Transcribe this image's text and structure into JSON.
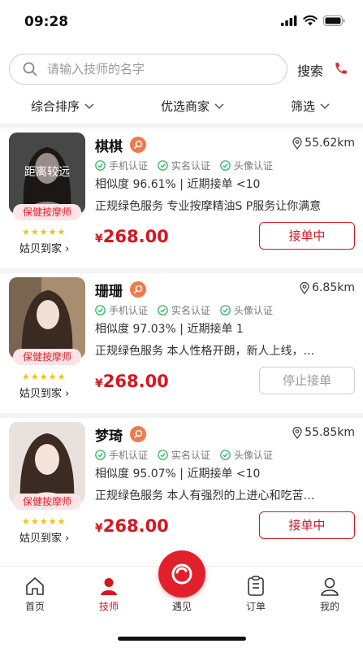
{
  "status_bar": {
    "time": "09:28"
  },
  "search": {
    "placeholder": "请输入技师的名字",
    "button_label": "搜索"
  },
  "filters": [
    {
      "label": "综合排序"
    },
    {
      "label": "优选商家"
    },
    {
      "label": "筛选"
    }
  ],
  "technicians": [
    {
      "name": "棋棋",
      "distance": "55.62km",
      "avatar_overlay": "距离较远",
      "role": "保健按摩师",
      "rating_stars": 5,
      "shop": "姑贝到家",
      "certs": [
        "手机认证",
        "实名认证",
        "头像认证"
      ],
      "stats": "相似度 96.61% | 近期接单 <10",
      "description": "正规绿色服务 专业按摩精油S P服务让你满意",
      "currency": "¥",
      "price": "268.00",
      "action_label": "接单中",
      "action_state": "active"
    },
    {
      "name": "珊珊",
      "distance": "6.85km",
      "avatar_overlay": "",
      "role": "保健按摩师",
      "rating_stars": 5,
      "shop": "姑贝到家",
      "certs": [
        "手机认证",
        "实名认证",
        "头像认证"
      ],
      "stats": "相似度 97.03% | 近期接单 1",
      "description": "正规绿色服务 本人性格开朗，新人上线，…",
      "currency": "¥",
      "price": "268.00",
      "action_label": "停止接单",
      "action_state": "stopped"
    },
    {
      "name": "梦琦",
      "distance": "55.85km",
      "avatar_overlay": "",
      "role": "保健按摩师",
      "rating_stars": 5,
      "shop": "姑贝到家",
      "certs": [
        "手机认证",
        "实名认证",
        "头像认证"
      ],
      "stats": "相似度 95.07% | 近期接单 <10",
      "description": "正规绿色服务 本人有强烈的上进心和吃苦…",
      "currency": "¥",
      "price": "268.00",
      "action_label": "接单中",
      "action_state": "active"
    }
  ],
  "tabbar": {
    "items": [
      {
        "label": "首页",
        "icon": "home-icon",
        "active": false
      },
      {
        "label": "技师",
        "icon": "person-icon",
        "active": true
      },
      {
        "label": "遇见",
        "icon": "meet-icon",
        "active": false
      },
      {
        "label": "订单",
        "icon": "order-icon",
        "active": false
      },
      {
        "label": "我的",
        "icon": "profile-icon",
        "active": false
      }
    ]
  },
  "colors": {
    "accent": "#d6161f",
    "star": "#f3c300",
    "cert_green": "#22b35a"
  }
}
